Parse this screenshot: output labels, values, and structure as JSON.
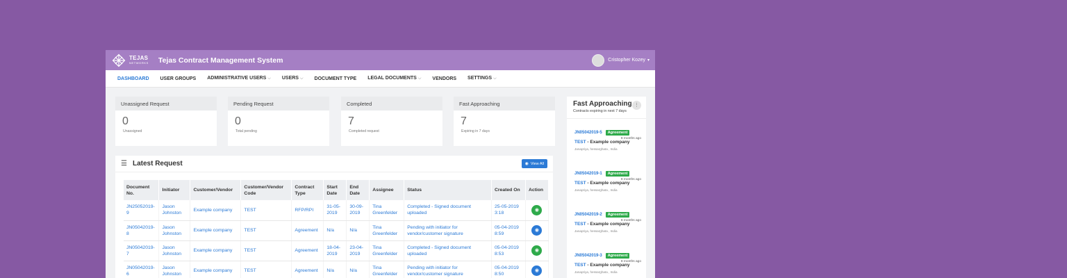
{
  "header": {
    "logo_text": "TEJAS",
    "logo_sub": "NETWORKS",
    "title": "Tejas Contract Management System",
    "user_name": "Cristopher Kozey"
  },
  "nav": [
    {
      "label": "DASHBOARD",
      "dropdown": false,
      "active": true
    },
    {
      "label": "USER GROUPS",
      "dropdown": false
    },
    {
      "label": "ADMINISTRATIVE USERS",
      "dropdown": true
    },
    {
      "label": "USERS",
      "dropdown": true
    },
    {
      "label": "DOCUMENT TYPE",
      "dropdown": false
    },
    {
      "label": "LEGAL DOCUMENTS",
      "dropdown": true
    },
    {
      "label": "VENDORS",
      "dropdown": false
    },
    {
      "label": "SETTINGS",
      "dropdown": true
    }
  ],
  "stats": [
    {
      "title": "Unassigned Request",
      "value": "0",
      "sub": "Unassigned"
    },
    {
      "title": "Pending Request",
      "value": "0",
      "sub": "Total pending"
    },
    {
      "title": "Completed",
      "value": "7",
      "sub": "Completed request"
    },
    {
      "title": "Fast Approaching",
      "value": "7",
      "sub": "Expiring in 7 days"
    }
  ],
  "latest": {
    "title": "Latest Request",
    "view_all": "View All",
    "columns": [
      "Document No.",
      "Initiator",
      "Customer/Vendor",
      "Customer/Vendor Code",
      "Contract Type",
      "Start Date",
      "End Date",
      "Assignee",
      "Status",
      "Created On",
      "Action"
    ],
    "rows": [
      {
        "doc": "JN25052019-9",
        "initiator": "Jason Johnston",
        "customer": "Example company",
        "code": "TEST",
        "type": "RFP/RPI",
        "start": "31-05-2019",
        "end": "30-09-2019",
        "assignee": "Tina Greenfelder",
        "status": "Completed - Signed document uploaded",
        "created": "25-05-2019 3:18",
        "action": "green"
      },
      {
        "doc": "JN05042019-8",
        "initiator": "Jason Johnston",
        "customer": "Example company",
        "code": "TEST",
        "type": "Agreement",
        "start": "N/a",
        "end": "N/a",
        "assignee": "Tina Greenfelder",
        "status": "Pending with initiator for vendor/customer signature",
        "created": "05-04-2019 8:59",
        "action": "blue"
      },
      {
        "doc": "JN05042019-7",
        "initiator": "Jason Johnston",
        "customer": "Example company",
        "code": "TEST",
        "type": "Agreement",
        "start": "18-04-2019",
        "end": "23-04-2019",
        "assignee": "Tina Greenfelder",
        "status": "Completed - Signed document uploaded",
        "created": "05-04-2019 8:53",
        "action": "green"
      },
      {
        "doc": "JN05042019-6",
        "initiator": "Jason Johnston",
        "customer": "Example company",
        "code": "TEST",
        "type": "Agreement",
        "start": "N/a",
        "end": "N/a",
        "assignee": "Tina Greenfelder",
        "status": "Pending with initiator for vendor/customer signature",
        "created": "05-04-2019 8:50",
        "action": "blue"
      }
    ]
  },
  "fast": {
    "title": "Fast Approaching",
    "subtitle": "Contracts expiring in next 7 days",
    "items": [
      {
        "id": "JN05042019-5",
        "badge": "Agreement",
        "ago": "8 months ago",
        "code": "TEST",
        "name": " - Example company",
        "loc": "Janapriya, hessarghata , India"
      },
      {
        "id": "JN05042019-1",
        "badge": "Agreement",
        "ago": "8 months ago",
        "code": "TEST",
        "name": " - Example company",
        "loc": "Janapriya, hessarghata , India"
      },
      {
        "id": "JN05042019-2",
        "badge": "Agreement",
        "ago": "8 months ago",
        "code": "TEST",
        "name": " - Example company",
        "loc": "Janapriya, hessarghata , India"
      },
      {
        "id": "JN05042019-3",
        "badge": "Agreement",
        "ago": "8 months ago",
        "code": "TEST",
        "name": " - Example company",
        "loc": "Janapriya, hessarghata , India"
      }
    ]
  },
  "colors": {
    "background": "#8659a3",
    "topbar": "#a57fc4",
    "accent": "#2b7ad6",
    "success": "#2eaa4a"
  }
}
